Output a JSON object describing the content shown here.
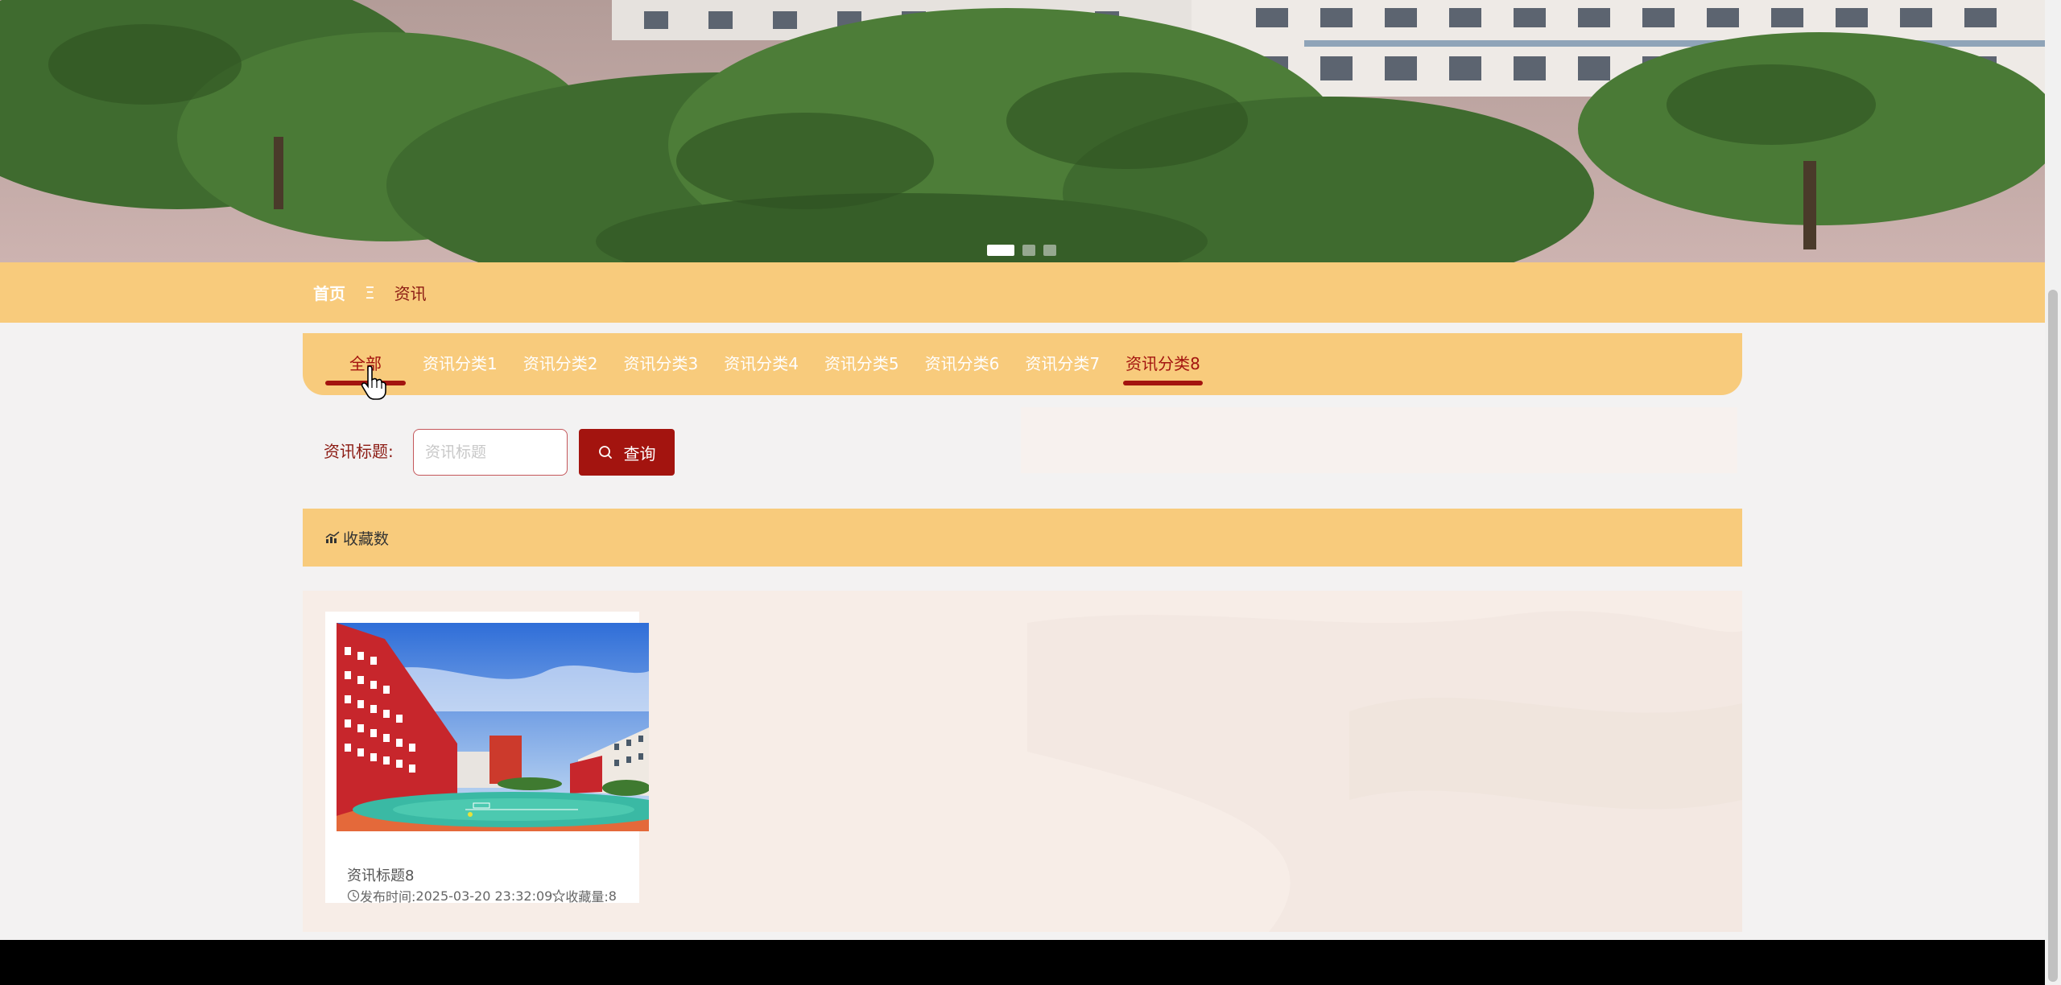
{
  "banner": {
    "slides": [
      "slide-1",
      "slide-2",
      "slide-3"
    ],
    "active_slide": 1
  },
  "breadcrumb": {
    "home": "首页",
    "separator": "Ξ",
    "current": "资讯"
  },
  "tabs": [
    {
      "label": "全部"
    },
    {
      "label": "资讯分类1"
    },
    {
      "label": "资讯分类2"
    },
    {
      "label": "资讯分类3"
    },
    {
      "label": "资讯分类4"
    },
    {
      "label": "资讯分类5"
    },
    {
      "label": "资讯分类6"
    },
    {
      "label": "资讯分类7"
    },
    {
      "label": "资讯分类8"
    }
  ],
  "search": {
    "label": "资讯标题:",
    "placeholder": "资讯标题",
    "value": "",
    "button_label": "查询"
  },
  "section": {
    "title": "收藏数",
    "icon": "chart-icon"
  },
  "cards": [
    {
      "title": "资讯标题8",
      "time_label": "发布时间:",
      "time": "2025-03-20 23:32:09",
      "fav_label": "收藏量:",
      "fav_count": "8"
    }
  ],
  "colors": {
    "accent": "#f8cb7c",
    "primary_red": "#a3140f",
    "footer": "#000000"
  }
}
